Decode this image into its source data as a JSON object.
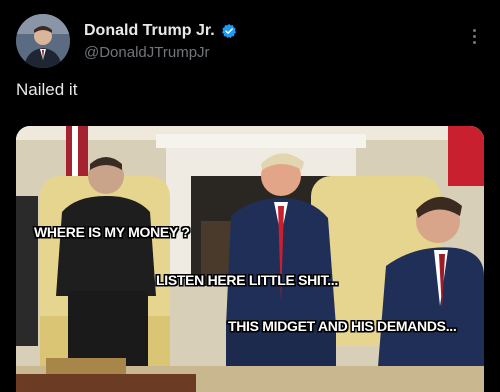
{
  "post": {
    "display_name": "Donald Trump Jr.",
    "handle": "@DonaldJTrumpJr",
    "text": "Nailed it",
    "verified": true
  },
  "icons": {
    "verified": "verified-badge-icon",
    "more": "more-options-icon"
  },
  "meme": {
    "caption_1": "WHERE IS MY MONEY ?",
    "caption_2": "LISTEN HERE LITTLE SHIT...",
    "caption_3": "THIS MIDGET AND HIS DEMANDS..."
  },
  "colors": {
    "background": "#000000",
    "primary_text": "#e7e9ea",
    "secondary_text": "#71767b",
    "verified_blue": "#1d9bf0"
  }
}
